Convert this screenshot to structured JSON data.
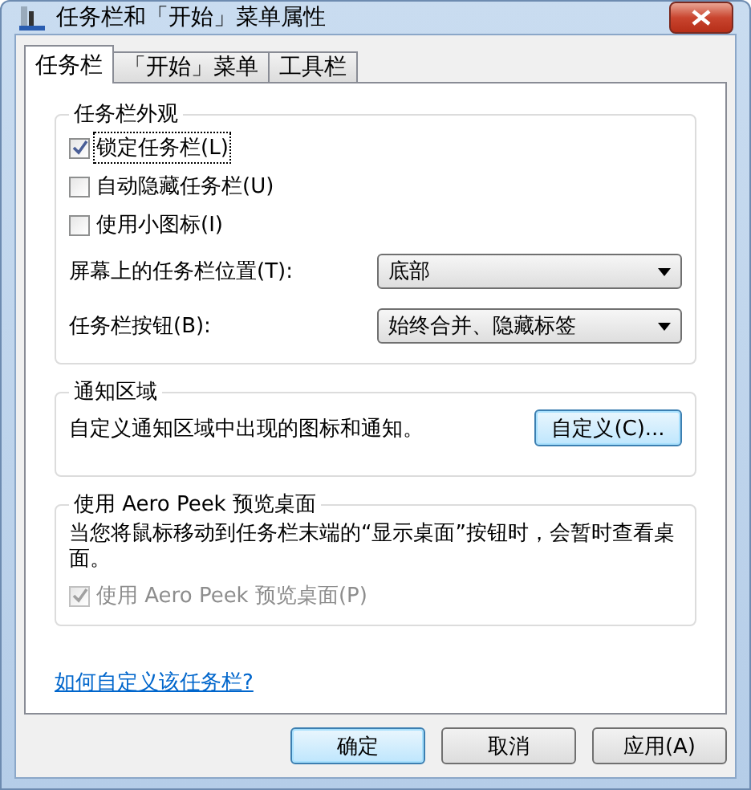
{
  "window": {
    "title": "任务栏和「开始」菜单属性"
  },
  "tabs": [
    {
      "label": "任务栏",
      "selected": true
    },
    {
      "label": "「开始」菜单",
      "selected": false
    },
    {
      "label": "工具栏",
      "selected": false
    }
  ],
  "appearance": {
    "title": "任务栏外观",
    "checkboxes": [
      {
        "label": "锁定任务栏(L)",
        "checked": true,
        "focused": true
      },
      {
        "label": "自动隐藏任务栏(U)",
        "checked": false,
        "focused": false
      },
      {
        "label": "使用小图标(I)",
        "checked": false,
        "focused": false
      }
    ],
    "dropdowns": [
      {
        "label": "屏幕上的任务栏位置(T):",
        "value": "底部"
      },
      {
        "label": "任务栏按钮(B):",
        "value": "始终合并、隐藏标签"
      }
    ]
  },
  "notification": {
    "title": "通知区域",
    "description": "自定义通知区域中出现的图标和通知。",
    "button": "自定义(C)..."
  },
  "aero_peek": {
    "title": "使用 Aero Peek 预览桌面",
    "description": "当您将鼠标移动到任务栏末端的“显示桌面”按钮时，会暂时查看桌面。",
    "checkbox": {
      "label": "使用 Aero Peek 预览桌面(P)",
      "checked": true,
      "disabled": true
    }
  },
  "link": "如何自定义该任务栏?",
  "buttons": [
    {
      "label": "确定",
      "default": true
    },
    {
      "label": "取消",
      "default": false
    },
    {
      "label": "应用(A)",
      "default": false
    }
  ]
}
